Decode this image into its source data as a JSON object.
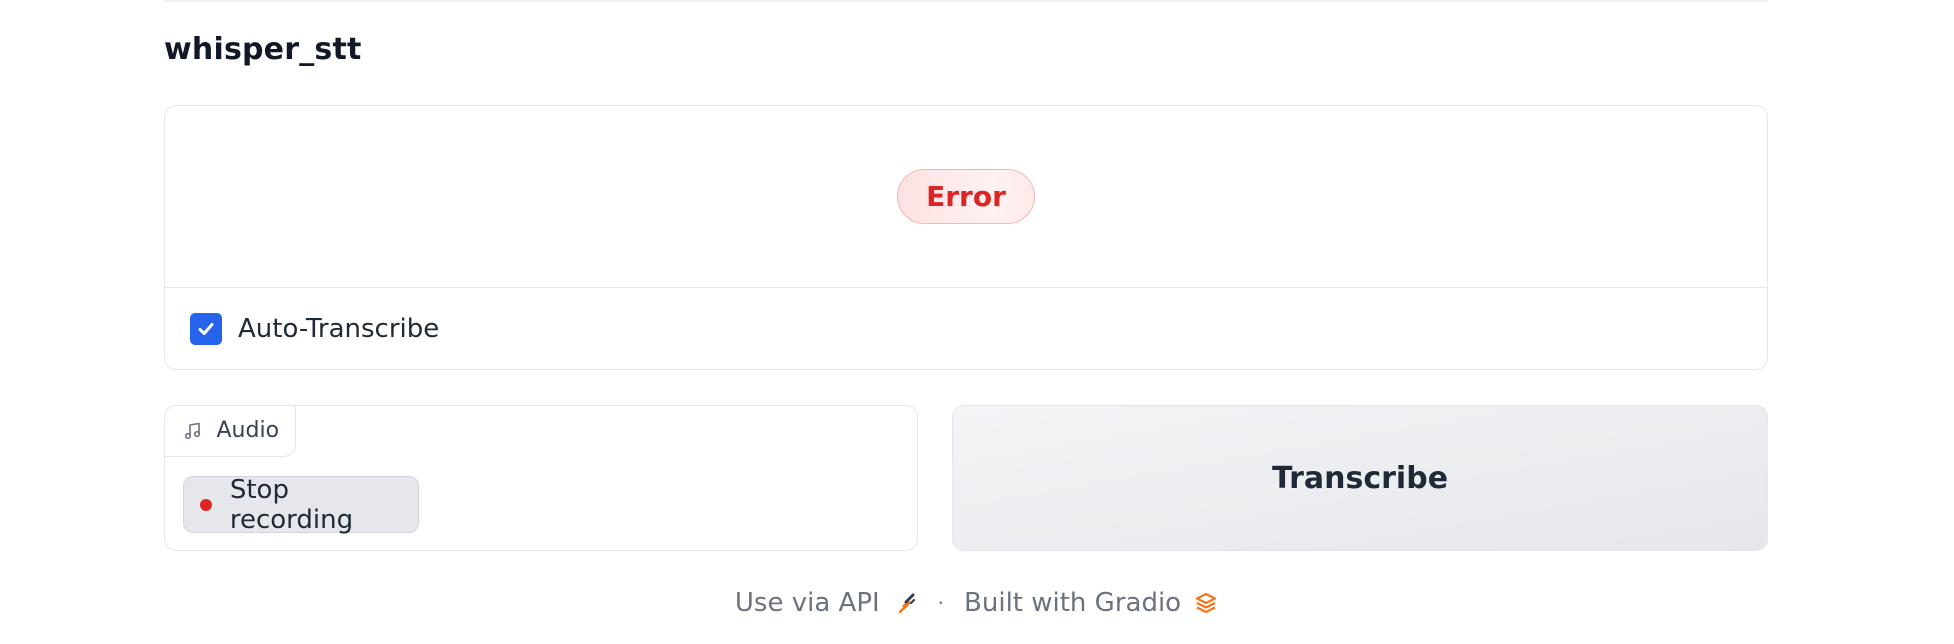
{
  "app": {
    "title": "whisper_stt"
  },
  "output": {
    "status": "Error",
    "auto_transcribe": {
      "label": "Auto-Transcribe",
      "checked": true
    }
  },
  "audio": {
    "tab_label": "Audio",
    "stop_button_label": "Stop recording"
  },
  "actions": {
    "transcribe_label": "Transcribe"
  },
  "footer": {
    "api_link": "Use via API",
    "separator": "·",
    "built_with": "Built with Gradio"
  },
  "colors": {
    "accent": "#2563eb",
    "error": "#dc2626",
    "gradio_orange": "#f97316"
  }
}
